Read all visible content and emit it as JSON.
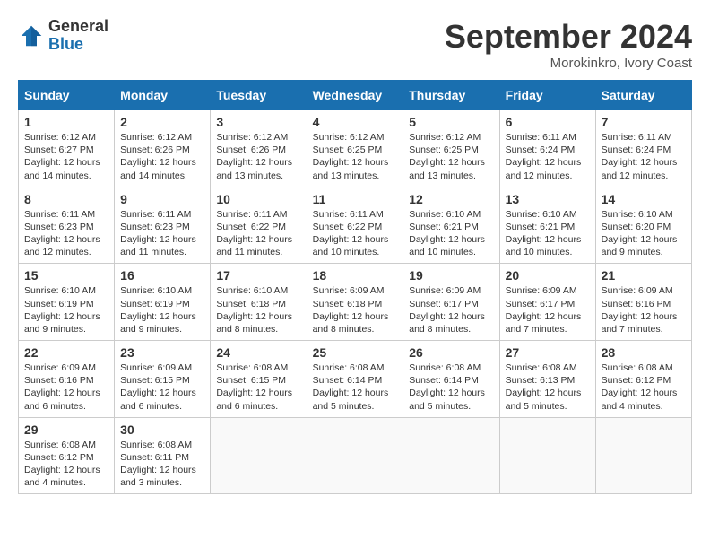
{
  "header": {
    "logo_general": "General",
    "logo_blue": "Blue",
    "month_title": "September 2024",
    "location": "Morokinkro, Ivory Coast"
  },
  "days_of_week": [
    "Sunday",
    "Monday",
    "Tuesday",
    "Wednesday",
    "Thursday",
    "Friday",
    "Saturday"
  ],
  "weeks": [
    [
      {
        "day": "1",
        "info": "Sunrise: 6:12 AM\nSunset: 6:27 PM\nDaylight: 12 hours\nand 14 minutes."
      },
      {
        "day": "2",
        "info": "Sunrise: 6:12 AM\nSunset: 6:26 PM\nDaylight: 12 hours\nand 14 minutes."
      },
      {
        "day": "3",
        "info": "Sunrise: 6:12 AM\nSunset: 6:26 PM\nDaylight: 12 hours\nand 13 minutes."
      },
      {
        "day": "4",
        "info": "Sunrise: 6:12 AM\nSunset: 6:25 PM\nDaylight: 12 hours\nand 13 minutes."
      },
      {
        "day": "5",
        "info": "Sunrise: 6:12 AM\nSunset: 6:25 PM\nDaylight: 12 hours\nand 13 minutes."
      },
      {
        "day": "6",
        "info": "Sunrise: 6:11 AM\nSunset: 6:24 PM\nDaylight: 12 hours\nand 12 minutes."
      },
      {
        "day": "7",
        "info": "Sunrise: 6:11 AM\nSunset: 6:24 PM\nDaylight: 12 hours\nand 12 minutes."
      }
    ],
    [
      {
        "day": "8",
        "info": "Sunrise: 6:11 AM\nSunset: 6:23 PM\nDaylight: 12 hours\nand 12 minutes."
      },
      {
        "day": "9",
        "info": "Sunrise: 6:11 AM\nSunset: 6:23 PM\nDaylight: 12 hours\nand 11 minutes."
      },
      {
        "day": "10",
        "info": "Sunrise: 6:11 AM\nSunset: 6:22 PM\nDaylight: 12 hours\nand 11 minutes."
      },
      {
        "day": "11",
        "info": "Sunrise: 6:11 AM\nSunset: 6:22 PM\nDaylight: 12 hours\nand 10 minutes."
      },
      {
        "day": "12",
        "info": "Sunrise: 6:10 AM\nSunset: 6:21 PM\nDaylight: 12 hours\nand 10 minutes."
      },
      {
        "day": "13",
        "info": "Sunrise: 6:10 AM\nSunset: 6:21 PM\nDaylight: 12 hours\nand 10 minutes."
      },
      {
        "day": "14",
        "info": "Sunrise: 6:10 AM\nSunset: 6:20 PM\nDaylight: 12 hours\nand 9 minutes."
      }
    ],
    [
      {
        "day": "15",
        "info": "Sunrise: 6:10 AM\nSunset: 6:19 PM\nDaylight: 12 hours\nand 9 minutes."
      },
      {
        "day": "16",
        "info": "Sunrise: 6:10 AM\nSunset: 6:19 PM\nDaylight: 12 hours\nand 9 minutes."
      },
      {
        "day": "17",
        "info": "Sunrise: 6:10 AM\nSunset: 6:18 PM\nDaylight: 12 hours\nand 8 minutes."
      },
      {
        "day": "18",
        "info": "Sunrise: 6:09 AM\nSunset: 6:18 PM\nDaylight: 12 hours\nand 8 minutes."
      },
      {
        "day": "19",
        "info": "Sunrise: 6:09 AM\nSunset: 6:17 PM\nDaylight: 12 hours\nand 8 minutes."
      },
      {
        "day": "20",
        "info": "Sunrise: 6:09 AM\nSunset: 6:17 PM\nDaylight: 12 hours\nand 7 minutes."
      },
      {
        "day": "21",
        "info": "Sunrise: 6:09 AM\nSunset: 6:16 PM\nDaylight: 12 hours\nand 7 minutes."
      }
    ],
    [
      {
        "day": "22",
        "info": "Sunrise: 6:09 AM\nSunset: 6:16 PM\nDaylight: 12 hours\nand 6 minutes."
      },
      {
        "day": "23",
        "info": "Sunrise: 6:09 AM\nSunset: 6:15 PM\nDaylight: 12 hours\nand 6 minutes."
      },
      {
        "day": "24",
        "info": "Sunrise: 6:08 AM\nSunset: 6:15 PM\nDaylight: 12 hours\nand 6 minutes."
      },
      {
        "day": "25",
        "info": "Sunrise: 6:08 AM\nSunset: 6:14 PM\nDaylight: 12 hours\nand 5 minutes."
      },
      {
        "day": "26",
        "info": "Sunrise: 6:08 AM\nSunset: 6:14 PM\nDaylight: 12 hours\nand 5 minutes."
      },
      {
        "day": "27",
        "info": "Sunrise: 6:08 AM\nSunset: 6:13 PM\nDaylight: 12 hours\nand 5 minutes."
      },
      {
        "day": "28",
        "info": "Sunrise: 6:08 AM\nSunset: 6:12 PM\nDaylight: 12 hours\nand 4 minutes."
      }
    ],
    [
      {
        "day": "29",
        "info": "Sunrise: 6:08 AM\nSunset: 6:12 PM\nDaylight: 12 hours\nand 4 minutes."
      },
      {
        "day": "30",
        "info": "Sunrise: 6:08 AM\nSunset: 6:11 PM\nDaylight: 12 hours\nand 3 minutes."
      },
      {
        "day": "",
        "info": ""
      },
      {
        "day": "",
        "info": ""
      },
      {
        "day": "",
        "info": ""
      },
      {
        "day": "",
        "info": ""
      },
      {
        "day": "",
        "info": ""
      }
    ]
  ]
}
